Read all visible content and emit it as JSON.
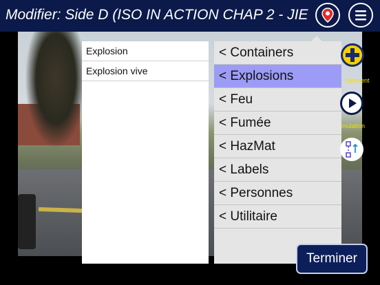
{
  "header": {
    "title": "Modifier: Side D (ISO IN ACTION CHAP 2 - JIE",
    "map_icon": "map-pin-icon",
    "menu_icon": "menu-icon"
  },
  "left_list": {
    "items": [
      "Explosion",
      "Explosion vive"
    ]
  },
  "categories": {
    "items": [
      "< Containers",
      "< Explosions",
      "< Feu",
      "< Fumée",
      "< HazMat",
      "< Labels",
      "< Personnes",
      "< Utilitaire"
    ],
    "selected": "< Explosions"
  },
  "tools": {
    "add_label": "l élément",
    "simulation_label": "mulation"
  },
  "footer": {
    "terminer": "Terminer"
  },
  "colors": {
    "header_bg": "#0b1a4a",
    "selected_bg": "#9c9cf6",
    "add_button": "#f5d000",
    "tool_label": "#f0e000"
  }
}
